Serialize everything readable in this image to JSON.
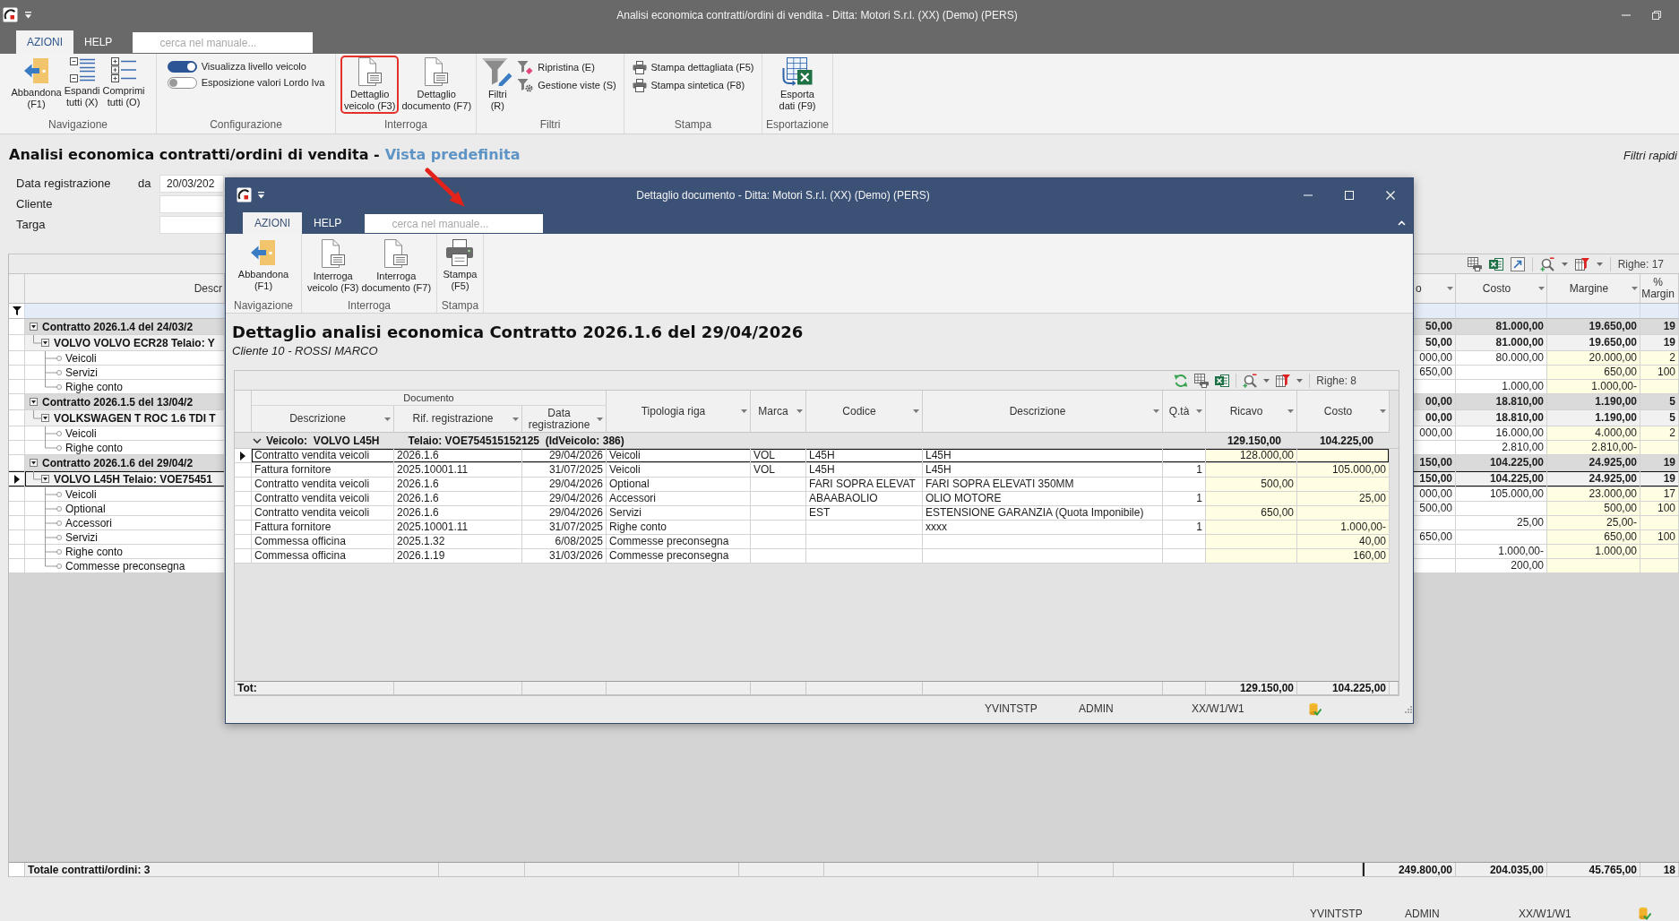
{
  "window": {
    "title": "Analisi economica contratti/ordini di vendita - Ditta: Motori S.r.l. (XX) (Demo) (PERS)",
    "tabs": [
      {
        "label": "AZIONI",
        "selected": true
      },
      {
        "label": "HELP",
        "selected": false
      }
    ],
    "search": {
      "placeholder": "cerca nel manuale..."
    }
  },
  "ribbon": {
    "groups": [
      {
        "label": "Navigazione",
        "items": [
          {
            "kind": "exit",
            "lines": [
              "Abbandona",
              "(F1)"
            ],
            "highlighted": false
          },
          {
            "kind": "expand",
            "lines": [
              "Espandi",
              "tutti (X)"
            ],
            "highlighted": false
          },
          {
            "kind": "collapse",
            "lines": [
              "Comprimi",
              "tutti (O)"
            ],
            "highlighted": false
          }
        ]
      },
      {
        "label": "Configurazione",
        "items": [
          {
            "kind": "toggle",
            "label": "Visualizza livello veicolo",
            "on": true
          },
          {
            "kind": "toggle",
            "label": "Esposizione valori Lordo Iva",
            "on": false
          }
        ]
      },
      {
        "label": "Interroga",
        "items": [
          {
            "kind": "document",
            "lines": [
              "Dettaglio",
              "veicolo (F3)"
            ],
            "highlighted": true
          },
          {
            "kind": "document",
            "lines": [
              "Dettaglio",
              "documento (F7)"
            ],
            "highlighted": false
          }
        ]
      },
      {
        "label": "Filtri",
        "items": [
          {
            "kind": "filter",
            "lines": [
              "Filtri",
              "(R)"
            ],
            "highlighted": false
          },
          {
            "kind": "reset",
            "label": "Ripristina (E)"
          },
          {
            "kind": "views",
            "label": "Gestione viste (S)"
          }
        ]
      },
      {
        "label": "Stampa",
        "items": [
          {
            "kind": "print",
            "label": "Stampa dettagliata (F5)"
          },
          {
            "kind": "print",
            "label": "Stampa sintetica (F8)"
          }
        ]
      },
      {
        "label": "Esportazione",
        "items": [
          {
            "kind": "excel",
            "lines": [
              "Esporta",
              "dati (F9)"
            ],
            "highlighted": false
          }
        ]
      }
    ]
  },
  "page": {
    "title": "Analisi economica contratti/ordini di vendita -",
    "view": "Vista predefinita",
    "quick_filters": "Filtri rapidi"
  },
  "filters": [
    {
      "label": "Data registrazione",
      "qualifier": "da",
      "value": "20/03/202"
    },
    {
      "label": "Cliente"
    },
    {
      "label": "Targa"
    }
  ],
  "grid": {
    "row_count": "Righe: 17",
    "columns": [
      {
        "label": "Descr"
      },
      {
        "label": "o"
      },
      {
        "label": "Costo"
      },
      {
        "label": "Margine"
      },
      {
        "label": "% Margin"
      }
    ],
    "rows": [
      {
        "label": "Contratto 2026.1.4 del 24/03/2",
        "cells": [
          "50,00",
          "81.000,00",
          "19.650,00",
          "19"
        ],
        "expanded": true,
        "selected": false,
        "children": [
          {
            "label": "VOLVO VOLVO ECR28 Telaio: Y",
            "cells": [
              "50,00",
              "81.000,00",
              "19.650,00",
              "19"
            ],
            "expanded": true,
            "selected": false,
            "children": [
              {
                "label": "Veicoli",
                "cells": [
                  "000,00",
                  "80.000,00",
                  "20.000,00",
                  "2"
                ],
                "selected": false
              },
              {
                "label": "Servizi",
                "cells": [
                  "650,00",
                  null,
                  "650,00",
                  "100"
                ],
                "selected": false
              },
              {
                "label": "Righe conto",
                "cells": [
                  null,
                  "1.000,00",
                  "1.000,00-",
                  null
                ],
                "selected": false
              }
            ]
          }
        ]
      },
      {
        "label": "Contratto 2026.1.5 del 13/04/2",
        "cells": [
          "00,00",
          "18.810,00",
          "1.190,00",
          "5"
        ],
        "expanded": true,
        "selected": false,
        "children": [
          {
            "label": "VOLKSWAGEN T ROC 1.6 TDI T",
            "cells": [
              "00,00",
              "18.810,00",
              "1.190,00",
              "5"
            ],
            "expanded": true,
            "selected": false,
            "children": [
              {
                "label": "Veicoli",
                "cells": [
                  "000,00",
                  "16.000,00",
                  "4.000,00",
                  "2"
                ],
                "selected": false
              },
              {
                "label": "Righe conto",
                "cells": [
                  null,
                  "2.810,00",
                  "2.810,00-",
                  null
                ],
                "selected": false
              }
            ]
          }
        ]
      },
      {
        "label": "Contratto 2026.1.6 del 29/04/2",
        "cells": [
          "150,00",
          "104.225,00",
          "24.925,00",
          "19"
        ],
        "expanded": true,
        "selected": false,
        "children": [
          {
            "label": "VOLVO L45H Telaio: VOE75451",
            "cells": [
              "150,00",
              "104.225,00",
              "24.925,00",
              "19"
            ],
            "expanded": true,
            "selected": true,
            "children": [
              {
                "label": "Veicoli",
                "cells": [
                  "000,00",
                  "105.000,00",
                  "23.000,00",
                  "17"
                ],
                "selected": false
              },
              {
                "label": "Optional",
                "cells": [
                  "500,00",
                  null,
                  "500,00",
                  "100"
                ],
                "selected": false
              },
              {
                "label": "Accessori",
                "cells": [
                  null,
                  "25,00",
                  "25,00-",
                  null
                ],
                "selected": false
              },
              {
                "label": "Servizi",
                "cells": [
                  "650,00",
                  null,
                  "650,00",
                  "100"
                ],
                "selected": false
              },
              {
                "label": "Righe conto",
                "cells": [
                  null,
                  "1.000,00-",
                  "1.000,00",
                  null
                ],
                "selected": false
              },
              {
                "label": "Commesse preconsegna",
                "cells": [
                  null,
                  "200,00",
                  null,
                  null
                ],
                "selected": false
              }
            ]
          }
        ]
      }
    ],
    "totals": {
      "label": "Totale contratti/ordini: 3",
      "values": [
        "249.800,00",
        "204.035,00",
        "45.765,00",
        "18"
      ]
    }
  },
  "status_bar": [
    "YVINTSTP",
    "ADMIN",
    "XX/W1/W1"
  ],
  "dialog": {
    "title": "Dettaglio documento - Ditta: Motori S.r.l. (XX) (Demo) (PERS)",
    "tabs": [
      {
        "label": "AZIONI",
        "selected": true
      },
      {
        "label": "HELP",
        "selected": false
      }
    ],
    "search": {
      "placeholder": "cerca nel manuale..."
    },
    "ribbon": {
      "groups": [
        {
          "label": "Navigazione",
          "items": [
            {
              "kind": "exit",
              "lines": [
                "Abbandona",
                "(F1)"
              ],
              "highlighted": false
            }
          ]
        },
        {
          "label": "Interroga",
          "items": [
            {
              "kind": "document",
              "lines": [
                "Interroga",
                "veicolo (F3)"
              ],
              "highlighted": false
            },
            {
              "kind": "document",
              "lines": [
                "Interroga",
                "documento (F7)"
              ],
              "highlighted": false
            }
          ]
        },
        {
          "label": "Stampa",
          "items": [
            {
              "kind": "printer",
              "lines": [
                "Stampa",
                "(F5)"
              ],
              "highlighted": false
            }
          ]
        }
      ]
    },
    "heading": "Dettaglio analisi economica Contratto 2026.1.6 del 29/04/2026",
    "subheading": "Cliente 10 - ROSSI MARCO",
    "grid": {
      "row_count": "Righe: 8",
      "band": "Documento",
      "columns": [
        {
          "label": "Descrizione",
          "in_band": true
        },
        {
          "label": "Rif. registrazione",
          "in_band": true
        },
        {
          "label": "Data registrazione",
          "in_band": true
        },
        {
          "label": "Tipologia riga",
          "in_band": false
        },
        {
          "label": "Marca",
          "in_band": false
        },
        {
          "label": "Codice",
          "in_band": false
        },
        {
          "label": "Descrizione",
          "in_band": false
        },
        {
          "label": "Q.tà",
          "in_band": false
        },
        {
          "label": "Ricavo",
          "in_band": false
        },
        {
          "label": "Costo",
          "in_band": false
        }
      ],
      "group": {
        "label": "Veicolo:  VOLVO L45H",
        "detail": "Telaio: VOE754515152125  (IdVeicolo: 386)",
        "values": [
          "129.150,00",
          "104.225,00"
        ],
        "expanded": true
      },
      "rows": [
        {
          "cells": [
            "Contratto vendita veicoli",
            "2026.1.6",
            "29/04/2026",
            "Veicoli",
            "VOL",
            "L45H",
            "L45H",
            null,
            "128.000,00",
            null
          ],
          "selected": true
        },
        {
          "cells": [
            "Fattura fornitore",
            "2025.10001.11",
            "31/07/2025",
            "Veicoli",
            "VOL",
            "L45H",
            "L45H",
            "1",
            null,
            "105.000,00"
          ],
          "selected": false
        },
        {
          "cells": [
            "Contratto vendita veicoli",
            "2026.1.6",
            "29/04/2026",
            "Optional",
            null,
            "FARI SOPRA ELEVAT",
            "FARI SOPRA ELEVATI 350MM",
            null,
            "500,00",
            null
          ],
          "selected": false
        },
        {
          "cells": [
            "Contratto vendita veicoli",
            "2026.1.6",
            "29/04/2026",
            "Accessori",
            null,
            "ABAABAOLIO",
            "OLIO MOTORE",
            "1",
            null,
            "25,00"
          ],
          "selected": false
        },
        {
          "cells": [
            "Contratto vendita veicoli",
            "2026.1.6",
            "29/04/2026",
            "Servizi",
            null,
            "EST",
            "ESTENSIONE GARANZIA (Quota Imponibile)",
            null,
            "650,00",
            null
          ],
          "selected": false
        },
        {
          "cells": [
            "Fattura fornitore",
            "2025.10001.11",
            "31/07/2025",
            "Righe conto",
            null,
            null,
            "xxxx",
            "1",
            null,
            "1.000,00-"
          ],
          "selected": false
        },
        {
          "cells": [
            "Commessa officina",
            "2025.1.32",
            "6/08/2025",
            "Commesse preconsegna",
            null,
            null,
            null,
            null,
            null,
            "40,00"
          ],
          "selected": false
        },
        {
          "cells": [
            "Commessa officina",
            "2026.1.19",
            "31/03/2026",
            "Commesse preconsegna",
            null,
            null,
            null,
            null,
            null,
            "160,00"
          ],
          "selected": false
        }
      ],
      "total": {
        "label": "Tot:",
        "values": [
          "129.150,00",
          "104.225,00"
        ]
      }
    },
    "status_bar": [
      "YVINTSTP",
      "ADMIN",
      "XX/W1/W1"
    ]
  }
}
